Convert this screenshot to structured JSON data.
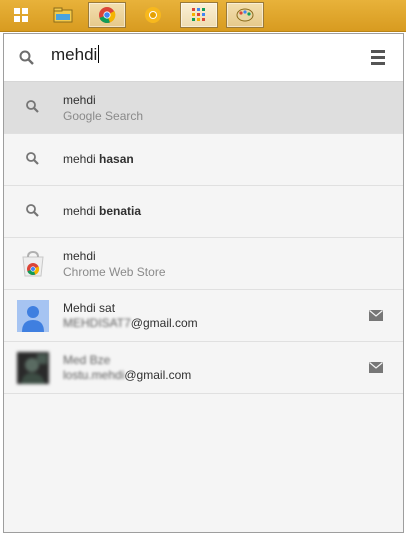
{
  "taskbar": {
    "buttons": [
      {
        "name": "start-button",
        "icon": "windows-icon"
      },
      {
        "name": "file-explorer-button",
        "icon": "folder-icon"
      },
      {
        "name": "chrome-button",
        "icon": "chrome-icon"
      },
      {
        "name": "chrome-canary-button",
        "icon": "chrome-canary-icon"
      },
      {
        "name": "app-launcher-button",
        "icon": "app-launcher-icon"
      },
      {
        "name": "paint-button",
        "icon": "paint-icon"
      }
    ]
  },
  "search": {
    "value": "mehdi",
    "icon": "search-icon",
    "menu_icon": "hamburger-menu-icon"
  },
  "results": [
    {
      "icon": "search-icon",
      "title_plain": "mehdi",
      "title_bold": "",
      "subtitle": "Google Search",
      "selected": true
    },
    {
      "icon": "search-icon",
      "title_plain": "mehdi ",
      "title_bold": "hasan",
      "subtitle": ""
    },
    {
      "icon": "search-icon",
      "title_plain": "mehdi ",
      "title_bold": "benatia",
      "subtitle": ""
    },
    {
      "icon": "chrome-web-store-icon",
      "title_plain": "mehdi",
      "title_bold": "",
      "subtitle": "Chrome Web Store"
    },
    {
      "icon": "default-avatar-icon",
      "title_plain": "Mehdi sat",
      "subtitle_blurred": "MEHDISAT7",
      "subtitle": "@gmail.com",
      "action_icon": "mail-icon"
    },
    {
      "icon": "contact-photo",
      "title_plain": "Med Bze",
      "subtitle_blurred": "lostu.mehdi",
      "subtitle": "@gmail.com",
      "action_icon": "mail-icon",
      "title_blurred": true
    }
  ],
  "colors": {
    "taskbar": "#dca42a",
    "panel": "#f5f5f5",
    "selected_row": "#dedede"
  }
}
